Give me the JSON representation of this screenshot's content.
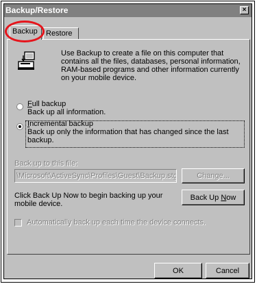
{
  "window": {
    "title": "Backup/Restore",
    "close_glyph": "×"
  },
  "tabs": [
    {
      "label": "Backup",
      "selected": true
    },
    {
      "label": "Restore",
      "selected": false
    }
  ],
  "annotation": {
    "highlight_color": "#e6141b"
  },
  "intro": {
    "icon": "backup-computer-icon",
    "text": "Use Backup to create a file on this computer that contains all the files, databases, personal information, RAM-based programs and other information currently on your mobile device."
  },
  "options": {
    "full": {
      "mnemonic": "F",
      "title_rest": "ull backup",
      "desc": "Back up all information.",
      "selected": false
    },
    "incremental": {
      "mnemonic": "I",
      "title_rest": "ncremental backup",
      "desc": "Back up only the information that has changed since the last backup.",
      "selected": true
    }
  },
  "backup_file": {
    "label": "Back up to this file:",
    "path": "\\Microsoft\\ActiveSync\\Profiles\\Guest\\Backup.stg",
    "change_label": "Change..."
  },
  "backup_now": {
    "instruction": "Click Back Up Now to begin backing up your mobile device.",
    "label_prefix": "Back Up ",
    "mnemonic": "N",
    "label_rest": "ow"
  },
  "auto_backup": {
    "label": "Automatically back up each time the device connects.",
    "checked": false
  },
  "footer": {
    "ok_label": "OK",
    "cancel_label": "Cancel"
  }
}
